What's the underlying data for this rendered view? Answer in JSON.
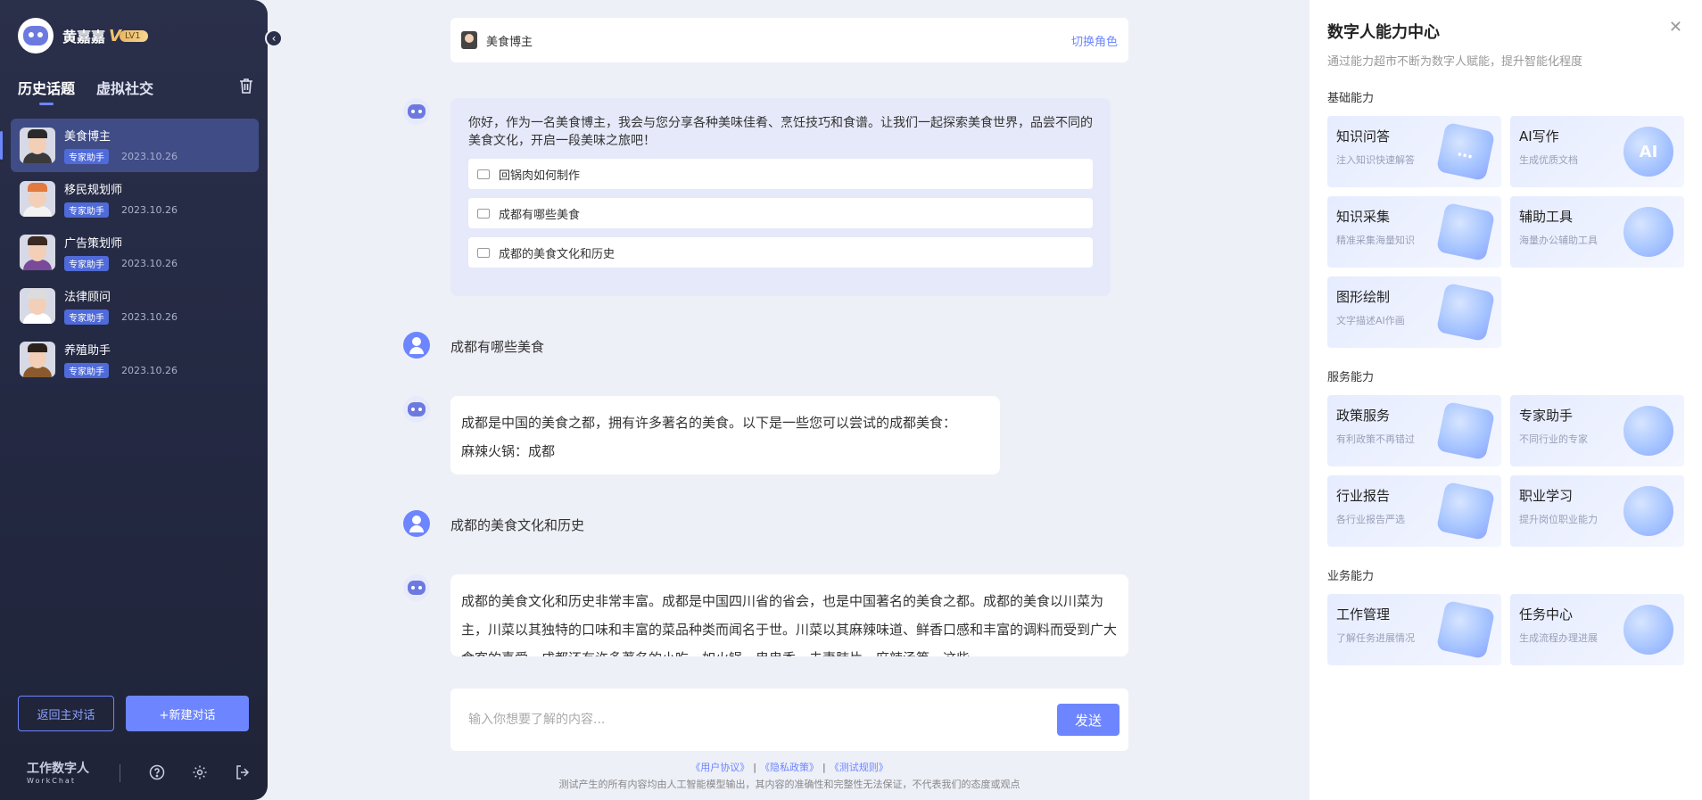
{
  "user": {
    "name": "黄嘉嘉",
    "vip_letter": "V",
    "level": "LV1"
  },
  "sidebar": {
    "tabs": [
      {
        "label": "历史话题"
      },
      {
        "label": "虚拟社交"
      }
    ],
    "history": [
      {
        "title": "美食博主",
        "badge": "专家助手",
        "date": "2023.10.26",
        "hat": "#2a2a2a",
        "body": "#3a3a3a"
      },
      {
        "title": "移民规划师",
        "badge": "专家助手",
        "date": "2023.10.26",
        "hat": "#e27a3f",
        "body": "#f2f2f2"
      },
      {
        "title": "广告策划师",
        "badge": "专家助手",
        "date": "2023.10.26",
        "hat": "#3b2a22",
        "body": "#7a4a9a"
      },
      {
        "title": "法律顾问",
        "badge": "专家助手",
        "date": "2023.10.26",
        "hat": "#dcdcdc",
        "body": "#ffffff"
      },
      {
        "title": "养殖助手",
        "badge": "专家助手",
        "date": "2023.10.26",
        "hat": "#2b221c",
        "body": "#8a5a2e"
      }
    ],
    "back_label": "返回主对话",
    "new_label": "+新建对话",
    "brand": "工作数字人",
    "brand_sub": "WorkChat"
  },
  "chat": {
    "role": "美食博主",
    "switch_label": "切换角色",
    "greeting": "你好，作为一名美食博主，我会与您分享各种美味佳肴、烹饪技巧和食谱。让我们一起探索美食世界，品尝不同的美食文化，开启一段美味之旅吧！",
    "suggestions": [
      "回锅肉如何制作",
      "成都有哪些美食",
      "成都的美食文化和历史"
    ],
    "q1": "成都有哪些美食",
    "a1": "成都是中国的美食之都，拥有许多著名的美食。以下是一些您可以尝试的成都美食：\n麻辣火锅：成都",
    "q2": "成都的美食文化和历史",
    "a2": "成都的美食文化和历史非常丰富。成都是中国四川省的省会，也是中国著名的美食之都。成都的美食以川菜为主，川菜以其独特的口味和丰富的菜品种类而闻名于世。川菜以其麻辣味道、鲜香口感和丰富的调料而受到广大食客的喜爱。成都还有许多著名的小吃，如火锅、串串香、夫妻肺片、麻辣汤等，这些",
    "input_placeholder": "输入你想要了解的内容...",
    "send_label": "发送",
    "links": [
      "《用户协议》",
      "《隐私政策》",
      "《测试规则》"
    ],
    "disclaimer": "测试产生的所有内容均由人工智能模型输出，其内容的准确性和完整性无法保证，不代表我们的态度或观点"
  },
  "panel": {
    "title": "数字人能力中心",
    "subtitle": "通过能力超市不断为数字人赋能，提升智能化程度",
    "sections": [
      {
        "title": "基础能力",
        "cards": [
          {
            "title": "知识问答",
            "desc": "注入知识快速解答",
            "glyph": "…"
          },
          {
            "title": "AI写作",
            "desc": "生成优质文档",
            "glyph": "AI"
          },
          {
            "title": "知识采集",
            "desc": "精准采集海量知识",
            "glyph": ""
          },
          {
            "title": "辅助工具",
            "desc": "海量办公辅助工具",
            "glyph": ""
          },
          {
            "title": "图形绘制",
            "desc": "文字描述AI作画",
            "glyph": ""
          }
        ]
      },
      {
        "title": "服务能力",
        "cards": [
          {
            "title": "政策服务",
            "desc": "有利政策不再错过",
            "glyph": ""
          },
          {
            "title": "专家助手",
            "desc": "不同行业的专家",
            "glyph": ""
          },
          {
            "title": "行业报告",
            "desc": "各行业报告严选",
            "glyph": ""
          },
          {
            "title": "职业学习",
            "desc": "提升岗位职业能力",
            "glyph": ""
          }
        ]
      },
      {
        "title": "业务能力",
        "cards": [
          {
            "title": "工作管理",
            "desc": "了解任务进展情况",
            "glyph": ""
          },
          {
            "title": "任务中心",
            "desc": "生成流程办理进展",
            "glyph": ""
          }
        ]
      }
    ]
  }
}
